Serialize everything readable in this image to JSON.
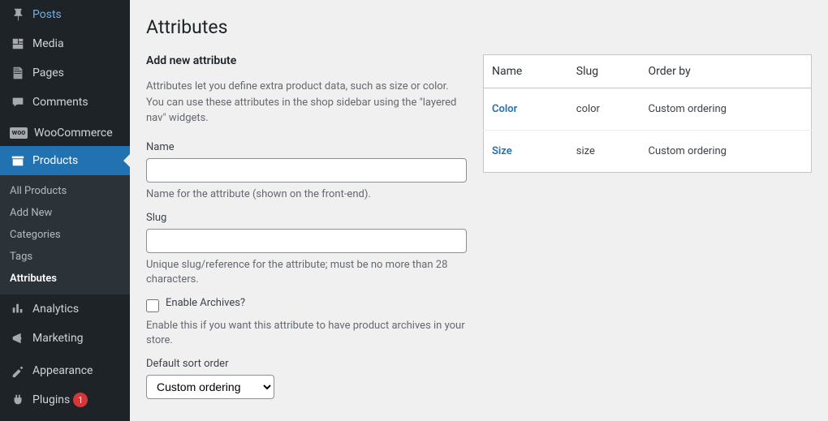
{
  "page": {
    "title": "Attributes"
  },
  "sidebar": {
    "posts": "Posts",
    "media": "Media",
    "pages": "Pages",
    "comments": "Comments",
    "woocommerce": "WooCommerce",
    "products": "Products",
    "analytics": "Analytics",
    "marketing": "Marketing",
    "appearance": "Appearance",
    "plugins": "Plugins",
    "plugins_badge": "1"
  },
  "submenu": {
    "all_products": "All Products",
    "add_new": "Add New",
    "categories": "Categories",
    "tags": "Tags",
    "attributes": "Attributes"
  },
  "form": {
    "heading": "Add new attribute",
    "description": "Attributes let you define extra product data, such as size or color. You can use these attributes in the shop sidebar using the \"layered nav\" widgets.",
    "name_label": "Name",
    "name_hint": "Name for the attribute (shown on the front-end).",
    "slug_label": "Slug",
    "slug_hint": "Unique slug/reference for the attribute; must be no more than 28 characters.",
    "archives_label": "Enable Archives?",
    "archives_hint": "Enable this if you want this attribute to have product archives in your store.",
    "sort_label": "Default sort order",
    "sort_value": "Custom ordering"
  },
  "table": {
    "headers": {
      "name": "Name",
      "slug": "Slug",
      "order_by": "Order by"
    },
    "rows": [
      {
        "name": "Color",
        "slug": "color",
        "order_by": "Custom ordering"
      },
      {
        "name": "Size",
        "slug": "size",
        "order_by": "Custom ordering"
      }
    ]
  }
}
